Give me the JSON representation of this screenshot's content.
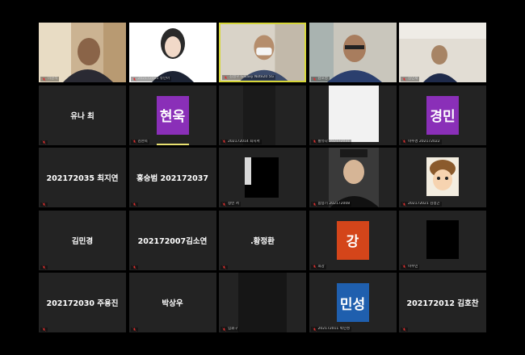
{
  "colors": {
    "background": "#000000",
    "tile": "#232323",
    "active_border": "#d6d63a",
    "mic_muted": "#e03030",
    "avatar_purple": "#8a2fb8",
    "avatar_orange": "#d4451a",
    "avatar_blue": "#1f5fae"
  },
  "tiles": [
    {
      "label": "이원석"
    },
    {
      "label": "202172005 유인아"
    },
    {
      "label": "김성우 Galaxy Note20 5G"
    },
    {
      "label": "남호영"
    },
    {
      "label": "김민재"
    },
    {
      "center_name": "유나 최"
    },
    {
      "avatar_text": "현욱",
      "label": "김현욱"
    },
    {
      "label": "202172014 최지서"
    },
    {
      "label": "황유나 202172031"
    },
    {
      "avatar_text": "경민",
      "label": "이수경 202172022"
    },
    {
      "center_name": "202172035 최지연"
    },
    {
      "center_name": "홍승범 202172037"
    },
    {
      "label": "정빈 서"
    },
    {
      "label": "함승기 202172008"
    },
    {
      "label": "202172021 김정곤"
    },
    {
      "center_name": "김민경"
    },
    {
      "center_name": "202172007김소연"
    },
    {
      "center_name": ".황정환"
    },
    {
      "avatar_text": "강",
      "label": "최강"
    },
    {
      "label": "이수민"
    },
    {
      "center_name": "202172030 주용진"
    },
    {
      "center_name": "박상우"
    },
    {
      "label": "임휘구"
    },
    {
      "avatar_text": "민성",
      "label": "202172011 박민성"
    },
    {
      "center_name": "202172012 김호찬"
    }
  ]
}
